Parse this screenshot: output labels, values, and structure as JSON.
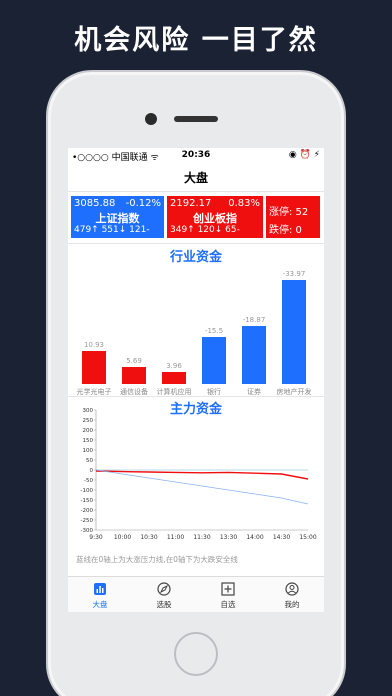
{
  "headline": "机会风险  一目了然",
  "status_bar": {
    "carrier": "•○○○○ 中国联通 ᯤ",
    "time": "20:36",
    "indicators": "◉ ⏰ ⚡"
  },
  "nav": {
    "title": "大盘"
  },
  "indexes": {
    "shanghai": {
      "value": "3085.88",
      "change": "-0.12%",
      "name": "上证指数",
      "stats": "479↑ 551↓ 121-"
    },
    "chuangye": {
      "value": "2192.17",
      "change": "0.83%",
      "name": "创业板指",
      "stats": "349↑ 120↓ 65-"
    },
    "limits": {
      "up": "涨停: 52",
      "down": "跌停: 0"
    }
  },
  "industry": {
    "title": "行业资金",
    "bars": [
      {
        "label": "光学光电子",
        "value": "10.93",
        "amount": 10.93,
        "color": "red"
      },
      {
        "label": "通信设备",
        "value": "5.69",
        "amount": 5.69,
        "color": "red"
      },
      {
        "label": "计算机应用",
        "value": "3.96",
        "amount": 3.96,
        "color": "red"
      },
      {
        "label": "银行",
        "value": "-15.5",
        "amount": 15.5,
        "color": "blue"
      },
      {
        "label": "证券",
        "value": "-18.87",
        "amount": 18.87,
        "color": "blue"
      },
      {
        "label": "房地产开发",
        "value": "-33.97",
        "amount": 33.97,
        "color": "blue"
      }
    ]
  },
  "main_funds": {
    "title": "主力资金",
    "note": "蓝线在0轴上为大涨压力线,在0轴下为大跌安全线"
  },
  "chart_data": {
    "type": "line",
    "title": "主力资金",
    "x": [
      "9:30",
      "10:00",
      "10:30",
      "11:00",
      "11:30",
      "13:30",
      "14:00",
      "14:30",
      "15:00"
    ],
    "ylim": [
      -300,
      300
    ],
    "yticks": [
      300,
      250,
      200,
      150,
      100,
      50,
      0,
      -50,
      -100,
      -150,
      -200,
      -250,
      -300
    ],
    "series": [
      {
        "values": [
          -5,
          -8,
          -10,
          -12,
          -14,
          -12,
          -16,
          -20,
          -45
        ],
        "color": "#ef0f0f"
      },
      {
        "values": [
          0,
          -20,
          -40,
          -60,
          -80,
          -100,
          -120,
          -140,
          -170
        ],
        "color": "#88b4f0"
      }
    ]
  },
  "tabs": [
    {
      "label": "大盘",
      "icon": "bar-chart-icon",
      "active": true
    },
    {
      "label": "选股",
      "icon": "compass-icon",
      "active": false
    },
    {
      "label": "自选",
      "icon": "plus-square-icon",
      "active": false
    },
    {
      "label": "我的",
      "icon": "user-icon",
      "active": false
    }
  ]
}
